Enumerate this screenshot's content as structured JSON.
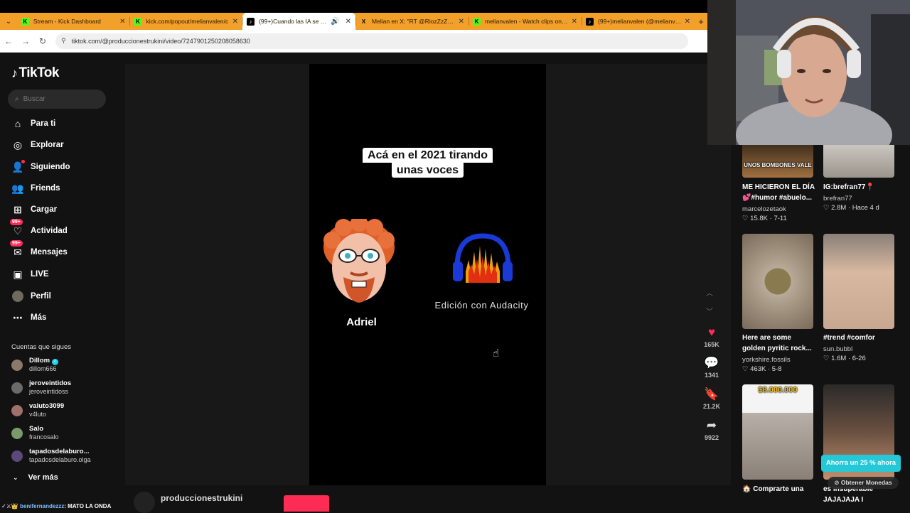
{
  "browser": {
    "tabs": [
      {
        "title": "Stream - Kick Dashboard",
        "favicon": "kick-icon",
        "active": false,
        "audio": false
      },
      {
        "title": "kick.com/popout/melianvalen/c",
        "favicon": "kick-icon",
        "active": false,
        "audio": false
      },
      {
        "title": "(99+)Cuando las IA se perfe",
        "favicon": "tiktok-icon",
        "active": true,
        "audio": true
      },
      {
        "title": "Melian en X: \"RT @RiozZzZ_: co",
        "favicon": "x-icon",
        "active": false,
        "audio": false
      },
      {
        "title": "melianvalen - Watch clips on Ki",
        "favicon": "kick-icon",
        "active": false,
        "audio": false
      },
      {
        "title": "(99+)melianvalen (@melianvale",
        "favicon": "tiktok-icon",
        "active": false,
        "audio": false
      }
    ],
    "url": "tiktok.com/@produccionestrukini/video/7247901250208058630",
    "tab_color": "#f3a02a"
  },
  "sidebar": {
    "logo": "TikTok",
    "search_placeholder": "Buscar",
    "nav": [
      {
        "label": "Para ti",
        "icon": "home-icon"
      },
      {
        "label": "Explorar",
        "icon": "compass-icon"
      },
      {
        "label": "Siguiendo",
        "icon": "user-follow-icon"
      },
      {
        "label": "Friends",
        "icon": "friends-icon"
      },
      {
        "label": "Cargar",
        "icon": "upload-icon"
      },
      {
        "label": "Actividad",
        "icon": "activity-icon",
        "badge": "99+"
      },
      {
        "label": "Mensajes",
        "icon": "message-icon",
        "badge": "99+"
      },
      {
        "label": "LIVE",
        "icon": "live-icon"
      },
      {
        "label": "Perfil",
        "icon": "avatar-icon"
      },
      {
        "label": "Más",
        "icon": "more-icon"
      }
    ],
    "following_title": "Cuentas que sigues",
    "following": [
      {
        "name": "Dillom",
        "handle": "dillom666",
        "verified": true,
        "color": "#8a7a6a"
      },
      {
        "name": "jeroveintidos",
        "handle": "jeroveintidoss",
        "verified": false,
        "color": "#6a6a6a"
      },
      {
        "name": "valuto3099",
        "handle": "v4luto",
        "verified": false,
        "color": "#a0706a"
      },
      {
        "name": "Salo",
        "handle": "francosalo",
        "verified": false,
        "color": "#7a9a6a"
      },
      {
        "name": "tapadosdelaburo...",
        "handle": "tapadosdelaburo.olga",
        "verified": false,
        "color": "#5a4a7a"
      }
    ],
    "see_more": "Ver más"
  },
  "video": {
    "caption_line1": "Acá en el 2021 tirando",
    "caption_line2": "unas voces",
    "left_label": "Adriel",
    "right_label": "Edición con Audacity",
    "author": "produccionestrukini"
  },
  "actions": [
    {
      "icon": "heart-icon",
      "count": "165K",
      "color": "#fe2c55"
    },
    {
      "icon": "comment-icon",
      "count": "1341",
      "color": "#ddd"
    },
    {
      "icon": "bookmark-icon",
      "count": "21.2K",
      "color": "#ddd"
    },
    {
      "icon": "share-icon",
      "count": "9922",
      "color": "#ddd"
    }
  ],
  "recommendations": [
    {
      "title_lines": [
        "ME HICIERON EL DÍA",
        "💕#humor #abuelo..."
      ],
      "author": "marcelozetaok",
      "likes": "15.8K",
      "date": "7-11",
      "thumb_caption": "UNOS BOMBONES VALE"
    },
    {
      "title_lines": [
        "IG:brefran77📍"
      ],
      "author": "brefran77",
      "likes": "2.8M",
      "date": "Hace 4 d",
      "thumb_caption": ""
    },
    {
      "title_lines": [
        "Here are some",
        "golden pyritic rock..."
      ],
      "author": "yorkshire.fossils",
      "likes": "463K",
      "date": "5-8",
      "thumb_caption": ""
    },
    {
      "title_lines": [
        "#trend #comfor"
      ],
      "author": "sun.bubbl",
      "likes": "1.6M",
      "date": "6-26",
      "thumb_caption": ""
    },
    {
      "title_lines": [
        "🏠 Comprarte una"
      ],
      "author": "",
      "likes": "",
      "date": "",
      "thumb_caption": "$8.000.000"
    },
    {
      "title_lines": [
        "es insuperable",
        "JAJAJAJA I"
      ],
      "author": "",
      "likes": "",
      "date": "",
      "thumb_caption": ""
    }
  ],
  "promo": {
    "label": "Ahorra un 25 % ahora",
    "coins": "Obtener Monedas"
  },
  "chat": {
    "user": "benifernandezzz",
    "message": ": MATO LA ONDA"
  }
}
